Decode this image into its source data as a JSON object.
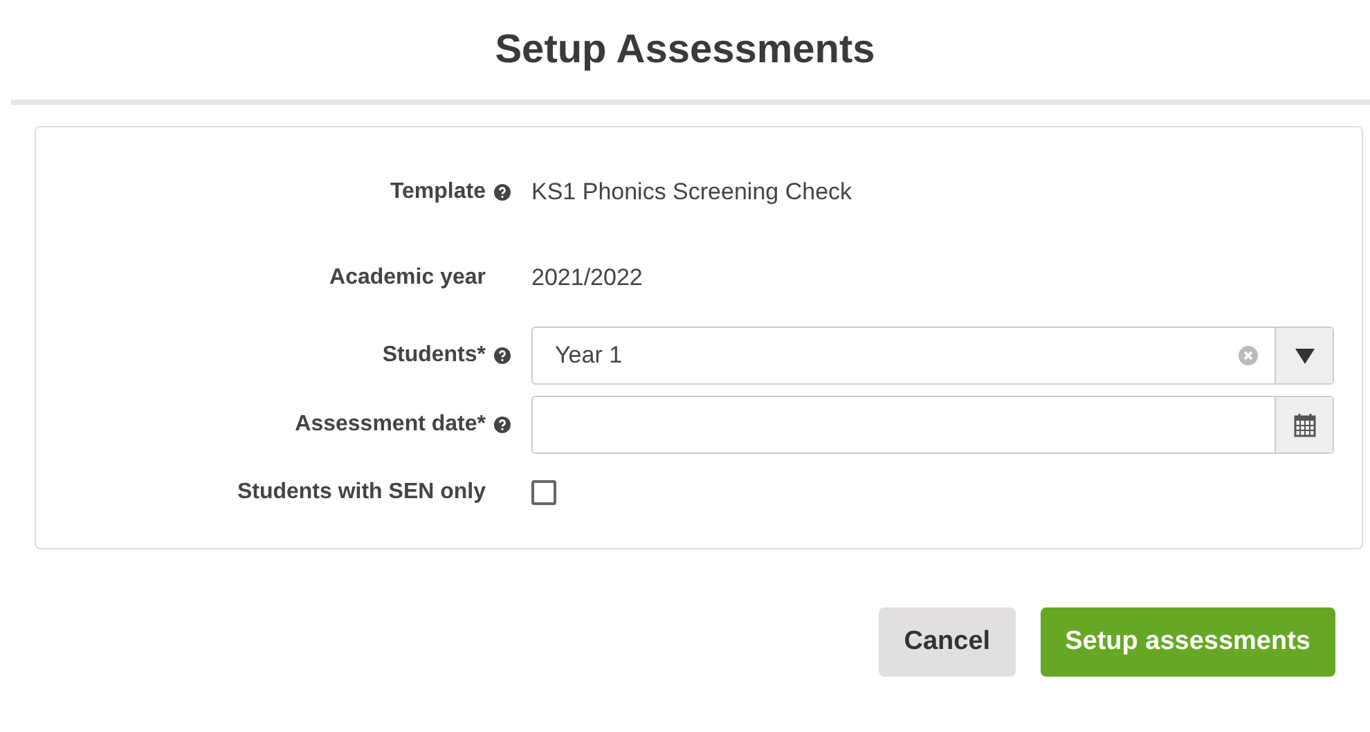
{
  "title": "Setup Assessments",
  "fields": [
    {
      "kind": "text",
      "label": "Template",
      "help": true,
      "value": "KS1 Phonics Screening Check"
    },
    {
      "kind": "text",
      "label": "Academic year",
      "value": "2021/2022"
    },
    {
      "kind": "select",
      "label": "Students*",
      "help": true,
      "value": "Year 1"
    },
    {
      "kind": "date",
      "label": "Assessment date*",
      "help": true
    },
    {
      "kind": "checkbox",
      "label": "Students with SEN only",
      "checked": false
    }
  ],
  "buttons": [
    {
      "kind": "secondary",
      "label": "Cancel"
    },
    {
      "kind": "primary",
      "label": "Setup assessments"
    }
  ]
}
